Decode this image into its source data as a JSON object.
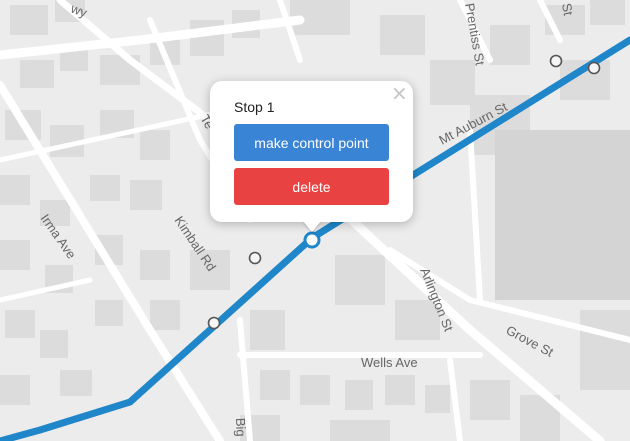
{
  "map": {
    "street_labels": [
      {
        "id": "wy",
        "text": "wy"
      },
      {
        "id": "prentiss",
        "text": "Prentiss St"
      },
      {
        "id": "st-top",
        "text": "St"
      },
      {
        "id": "mt-auburn",
        "text": "Mt Auburn St"
      },
      {
        "id": "te",
        "text": "Te"
      },
      {
        "id": "irma",
        "text": "Irma Ave"
      },
      {
        "id": "kimball",
        "text": "Kimball Rd"
      },
      {
        "id": "arlington",
        "text": "Arlington St"
      },
      {
        "id": "grove",
        "text": "Grove St"
      },
      {
        "id": "wells",
        "text": "Wells Ave"
      },
      {
        "id": "big",
        "text": "Big"
      }
    ],
    "route_color": "#1f87c9",
    "stop_color": "#1f87c9",
    "background_color": "#ececec"
  },
  "popup": {
    "title": "Stop 1",
    "close_glyph": "×",
    "control_point_label": "make control point",
    "delete_label": "delete",
    "control_point_color": "#3a84d6",
    "delete_color": "#e84342"
  }
}
